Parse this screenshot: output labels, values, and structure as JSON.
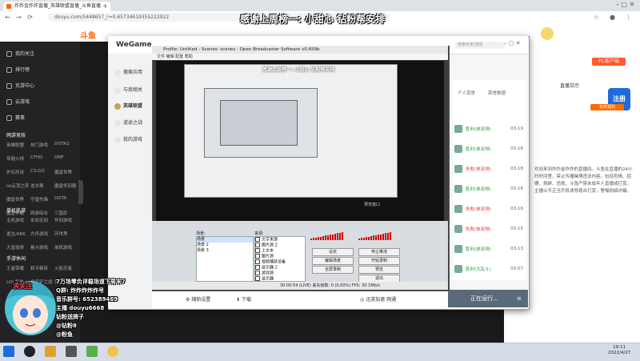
{
  "browser": {
    "tabs": [
      {
        "label": "炸炸金炸炸直播_英雄联盟直播_斗鱼直播",
        "active": true
      },
      {
        "label": "",
        "active": false
      }
    ],
    "url": "douyu.com/5448657_r=0.65734619355222922"
  },
  "banner": "感谢上周榜一: 小甜心   钻粉帮安排",
  "douyu": {
    "logo": "斗鱼",
    "sidebar_top": [
      {
        "icon": "heart-icon",
        "label": "我的关注"
      },
      {
        "icon": "trophy-icon",
        "label": "排行榜"
      },
      {
        "icon": "video-icon",
        "label": "页游中心"
      },
      {
        "icon": "gamepad-icon",
        "label": "云游戏"
      },
      {
        "icon": "diamond-icon",
        "label": "赛事"
      }
    ],
    "sidebar_sections": [
      {
        "title": "网游竞技",
        "items": [
          "英雄联盟",
          "热门游戏",
          "DOTA2",
          "穿越火线",
          "CFHD",
          "DNF",
          "炉石传说",
          "CS:GO",
          "魔兽世界",
          "lol云顶之弈",
          "逆水寒",
          "魔兽怀旧服",
          "魔兽世界",
          "守望先锋",
          "DOTA",
          "魔兽争霸",
          "网游综合",
          "三国杀"
        ]
      },
      {
        "title": "单机热游",
        "items": [
          "主机游戏",
          "永劫无间",
          "怀旧游戏",
          "逃生/ARK",
          "方舟游戏",
          "环世界",
          "大富翁类",
          "格斗游戏",
          "单机游戏"
        ]
      },
      {
        "title": "手游休闲",
        "items": [
          "王者荣耀",
          "和平精英",
          "火影忍者",
          "LOL手游",
          "金铲铲之战",
          "第五人格"
        ]
      }
    ],
    "right_labels": [
      "PC客户端",
      "直播日历",
      "有奖福利"
    ],
    "right_text": [
      "欢迎来到炸炸金炸炸的直播间。斗鱼在直播的24小时时间里，禁止传播赌博违法内容，包括色情、招嫖、挑衅、违规、斗鱼严禁未成年人直播或打赏。主播以不正当手段诱导观众打赏，警惕网络诈骗。"
    ]
  },
  "wegame": {
    "brand": "WeGame",
    "nav": [
      {
        "icon": "search-icon",
        "label": "搜索应用"
      },
      {
        "icon": "news-icon",
        "label": "与我相关"
      },
      {
        "icon": "game-icon",
        "label": "英雄联盟"
      },
      {
        "icon": "dota-icon",
        "label": "道途之战"
      },
      {
        "icon": "more-icon",
        "label": "我的游戏"
      }
    ],
    "search_placeholder": "搜索玩家/游戏",
    "footer": {
      "assist": "辅助设置",
      "download": "下载",
      "speed": "迅游加速 网通",
      "status": "正在运行..."
    },
    "list": [
      {
        "status": "胜利",
        "mode": "单双排",
        "date": "03-19"
      },
      {
        "status": "胜利",
        "mode": "单双排",
        "date": "03-18"
      },
      {
        "status": "失败",
        "mode": "单双排",
        "date": "03-18"
      },
      {
        "status": "胜利",
        "mode": "单双排",
        "date": "03-16"
      },
      {
        "status": "失败",
        "mode": "单双排",
        "date": "03-16"
      },
      {
        "status": "失败",
        "mode": "单双排",
        "date": "03-15"
      },
      {
        "status": "胜利",
        "mode": "单双排",
        "date": "03-13"
      },
      {
        "status": "胜利",
        "mode": "大乱斗",
        "date": "03-07"
      }
    ],
    "tabs": [
      "个人荣誉",
      "荣誉数据"
    ]
  },
  "obs": {
    "title": "Profile: Untitled - Scenes: scenes - Open Broadcaster Software v0.659b",
    "menu": "文件  编辑  配置  帮助",
    "scenes_label": "场景:",
    "scenes": [
      "场景",
      "场景 2",
      "场景 3"
    ],
    "sources_label": "来源:",
    "sources": [
      "文字来源",
      "图片源 2",
      "上文本",
      "图片源",
      "视频捕获设备",
      "显示器 2",
      "游戏源",
      "显示器"
    ],
    "buttons": [
      "设定",
      "停止推流",
      "编辑场景",
      "开始录制",
      "全屏录制",
      "预览",
      "退出"
    ],
    "status": "30:00:54 (LIVE)   丢失帧数: 0 (0.00%)   FPS: 30   1Mb/s",
    "preview_label": "预览窗口"
  },
  "overlay": {
    "follow": "求关注",
    "lines": [
      "7万场零负评稳场道下周末7",
      "Q群: 炸炸炸炸炸号",
      "音乐群号: 652389469",
      "主播 douyu6668",
      "钻粉送牌子",
      "@钻粉8",
      "@粉鱼"
    ]
  },
  "taskbar": {
    "time": "19:11",
    "date": "2022/4/27"
  },
  "colors": {
    "accent": "#ff6a00",
    "win": "#2e9e44",
    "lose": "#d94141"
  }
}
